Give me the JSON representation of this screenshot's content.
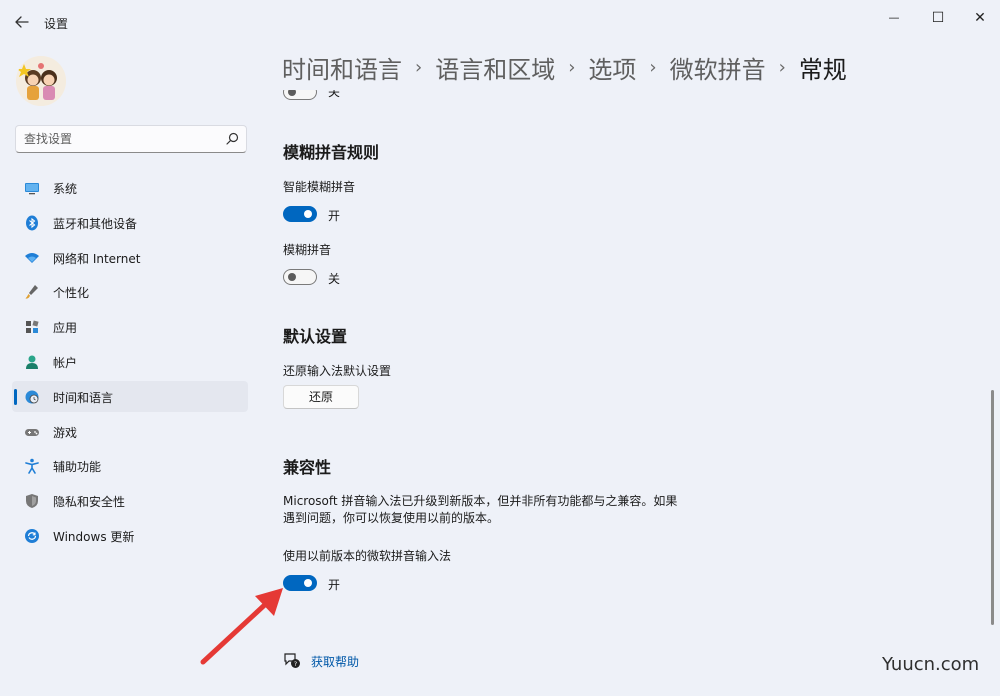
{
  "window": {
    "title": "设置",
    "back_icon": "arrow-left-icon",
    "controls": {
      "minimize": "—",
      "maximize": "☐",
      "close": "✕"
    }
  },
  "sidebar": {
    "search": {
      "placeholder": "查找设置",
      "value": ""
    },
    "items": [
      {
        "label": "系统",
        "icon": "monitor-icon",
        "active": false
      },
      {
        "label": "蓝牙和其他设备",
        "icon": "bluetooth-icon",
        "active": false
      },
      {
        "label": "网络和 Internet",
        "icon": "wifi-icon",
        "active": false
      },
      {
        "label": "个性化",
        "icon": "brush-icon",
        "active": false
      },
      {
        "label": "应用",
        "icon": "apps-icon",
        "active": false
      },
      {
        "label": "帐户",
        "icon": "person-icon",
        "active": false
      },
      {
        "label": "时间和语言",
        "icon": "globe-clock-icon",
        "active": true
      },
      {
        "label": "游戏",
        "icon": "gamepad-icon",
        "active": false
      },
      {
        "label": "辅助功能",
        "icon": "accessibility-icon",
        "active": false
      },
      {
        "label": "隐私和安全性",
        "icon": "shield-icon",
        "active": false
      },
      {
        "label": "Windows 更新",
        "icon": "update-icon",
        "active": false
      }
    ]
  },
  "breadcrumb": {
    "items": [
      "时间和语言",
      "语言和区域",
      "选项",
      "微软拼音"
    ],
    "separator": "›",
    "current": "常规"
  },
  "main": {
    "top_partial_toggle_state": "关",
    "fuzzy": {
      "title": "模糊拼音规则",
      "smart_label": "智能模糊拼音",
      "smart_state": "开",
      "smart_on": true,
      "fuzzy_label": "模糊拼音",
      "fuzzy_state": "关",
      "fuzzy_on": false
    },
    "defaults": {
      "title": "默认设置",
      "restore_label": "还原输入法默认设置",
      "restore_button": "还原"
    },
    "compat": {
      "title": "兼容性",
      "description": "Microsoft 拼音输入法已升级到新版本，但并非所有功能都与之兼容。如果遇到问题，你可以恢复使用以前的版本。",
      "legacy_label": "使用以前版本的微软拼音输入法",
      "legacy_state": "开",
      "legacy_on": true
    },
    "help": {
      "label": "获取帮助"
    }
  },
  "annotation": {
    "color": "#e53935"
  },
  "watermark": "Yuucn.com",
  "colors": {
    "accent": "#0067c0",
    "background": "#eef1f8"
  }
}
